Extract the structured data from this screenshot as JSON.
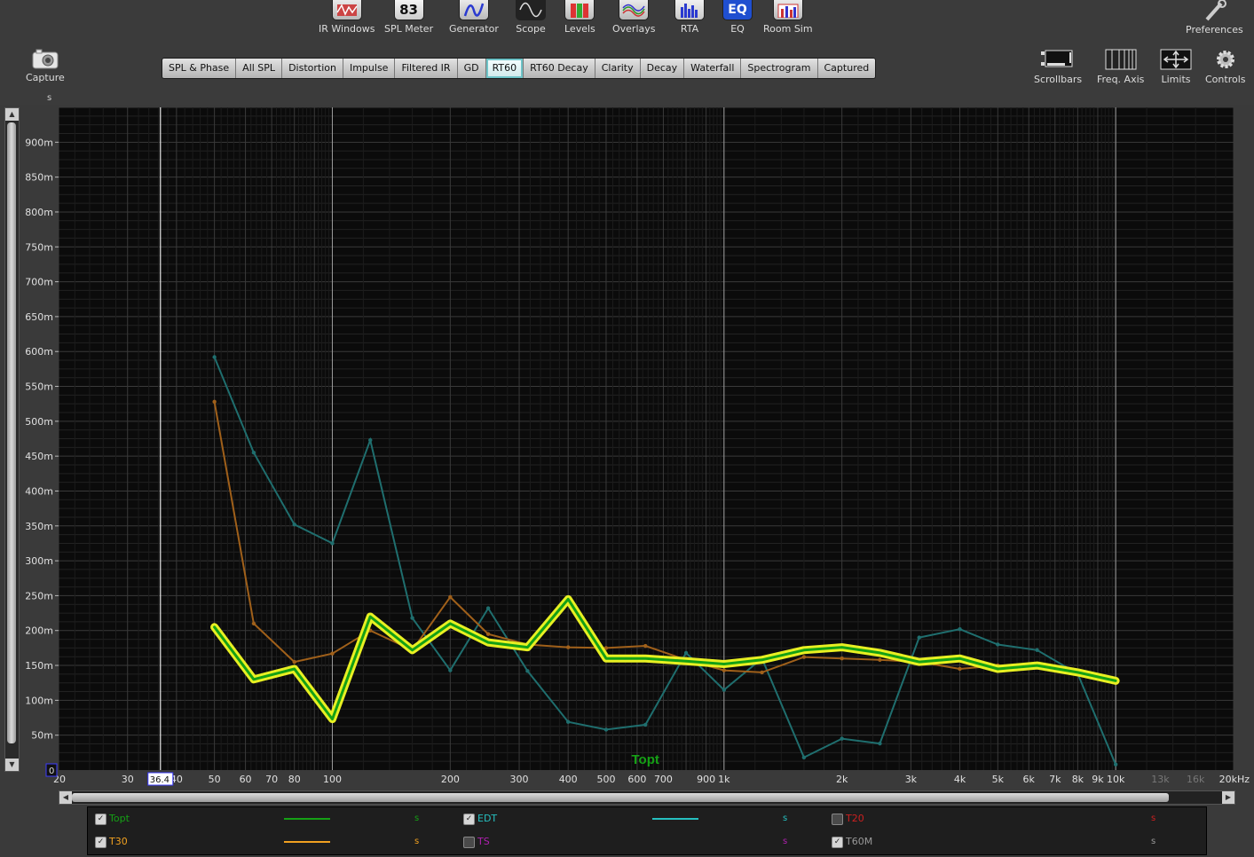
{
  "toolbar": {
    "tools": [
      {
        "id": "irwin",
        "label": "IR Windows",
        "icon": "ir-windows-icon"
      },
      {
        "id": "splmeter",
        "label": "SPL Meter",
        "icon": "spl-meter-icon",
        "value": "83"
      },
      {
        "id": "generator",
        "label": "Generator",
        "icon": "generator-icon"
      },
      {
        "id": "scope",
        "label": "Scope",
        "icon": "scope-icon"
      },
      {
        "id": "levels",
        "label": "Levels",
        "icon": "levels-icon"
      },
      {
        "id": "overlays",
        "label": "Overlays",
        "icon": "overlays-icon"
      },
      {
        "id": "rta",
        "label": "RTA",
        "icon": "rta-icon"
      },
      {
        "id": "eq",
        "label": "EQ",
        "icon": "eq-icon",
        "value": "EQ"
      },
      {
        "id": "roomsim",
        "label": "Room Sim",
        "icon": "room-sim-icon"
      }
    ],
    "preferences_label": "Preferences",
    "capture_label": "Capture",
    "right_tools": [
      {
        "id": "scrollbars",
        "label": "Scrollbars",
        "icon": "scrollbars-icon"
      },
      {
        "id": "freqaxis",
        "label": "Freq. Axis",
        "icon": "freq-axis-icon"
      },
      {
        "id": "limits",
        "label": "Limits",
        "icon": "limits-icon"
      },
      {
        "id": "controls",
        "label": "Controls",
        "icon": "gear-icon"
      }
    ]
  },
  "tabs": [
    "SPL & Phase",
    "All SPL",
    "Distortion",
    "Impulse",
    "Filtered IR",
    "GD",
    "RT60",
    "RT60 Decay",
    "Clarity",
    "Decay",
    "Waterfall",
    "Spectrogram",
    "Captured"
  ],
  "active_tab": "RT60",
  "colors": {
    "plot_bg": "#0b0b0b",
    "grid": "#2e2e2e",
    "topt": "#15a015",
    "topt_glow": "#e8f022",
    "t30": "#a0601a",
    "t30_legend": "#f0a020",
    "edt": "#1f6e6e",
    "edt_legend": "#26c0c0",
    "t20": "#cc2020",
    "ts": "#b020b0",
    "t60m": "#999999"
  },
  "chart_data": {
    "type": "line",
    "x_scale": "log",
    "xlim": [
      20,
      20000
    ],
    "ylim": [
      0,
      0.95
    ],
    "ylabel": "s",
    "y_ticks": [
      "900m",
      "850m",
      "800m",
      "750m",
      "700m",
      "650m",
      "600m",
      "550m",
      "500m",
      "450m",
      "400m",
      "350m",
      "300m",
      "250m",
      "200m",
      "150m",
      "100m",
      "50m"
    ],
    "y_tick_values": [
      0.9,
      0.85,
      0.8,
      0.75,
      0.7,
      0.65,
      0.6,
      0.55,
      0.5,
      0.45,
      0.4,
      0.35,
      0.3,
      0.25,
      0.2,
      0.15,
      0.1,
      0.05
    ],
    "x_ticks": [
      {
        "v": 20,
        "t": "20"
      },
      {
        "v": 30,
        "t": "30"
      },
      {
        "v": 40,
        "t": "40"
      },
      {
        "v": 50,
        "t": "50"
      },
      {
        "v": 60,
        "t": "60"
      },
      {
        "v": 70,
        "t": "70"
      },
      {
        "v": 80,
        "t": "80"
      },
      {
        "v": 100,
        "t": "100"
      },
      {
        "v": 200,
        "t": "200"
      },
      {
        "v": 300,
        "t": "300"
      },
      {
        "v": 400,
        "t": "400"
      },
      {
        "v": 500,
        "t": "500"
      },
      {
        "v": 600,
        "t": "600"
      },
      {
        "v": 700,
        "t": "700"
      },
      {
        "v": 900,
        "t": "900"
      },
      {
        "v": 1000,
        "t": "1k"
      },
      {
        "v": 2000,
        "t": "2k"
      },
      {
        "v": 3000,
        "t": "3k"
      },
      {
        "v": 4000,
        "t": "4k"
      },
      {
        "v": 5000,
        "t": "5k"
      },
      {
        "v": 6000,
        "t": "6k"
      },
      {
        "v": 7000,
        "t": "7k"
      },
      {
        "v": 8000,
        "t": "8k"
      },
      {
        "v": 9000,
        "t": "9k"
      },
      {
        "v": 10000,
        "t": "10k"
      },
      {
        "v": 13000,
        "t": "13k"
      },
      {
        "v": 16000,
        "t": "16k"
      },
      {
        "v": 20000,
        "t": "20kHz"
      }
    ],
    "x_ticks_dim_from": 13000,
    "cursor_freq": 36.4,
    "cursor_label": "36.4",
    "y_zero_label": "0",
    "marker_lines": [
      36.4,
      100,
      1000,
      10000
    ],
    "annotation": "Topt",
    "annotation_freq": 400,
    "series": [
      {
        "name": "EDT",
        "color": "#1f6e6e",
        "x": [
          50,
          63,
          80,
          100,
          125,
          160,
          200,
          250,
          315,
          400,
          500,
          630,
          800,
          1000,
          1250,
          1600,
          2000,
          2500,
          3150,
          4000,
          5000,
          6300,
          8000,
          10000
        ],
        "y": [
          0.592,
          0.455,
          0.352,
          0.325,
          0.473,
          0.218,
          0.143,
          0.232,
          0.142,
          0.069,
          0.058,
          0.065,
          0.168,
          0.115,
          0.16,
          0.018,
          0.045,
          0.038,
          0.19,
          0.202,
          0.18,
          0.172,
          0.138,
          0.008
        ]
      },
      {
        "name": "T30",
        "color": "#a0601a",
        "x": [
          50,
          63,
          80,
          100,
          125,
          160,
          200,
          250,
          315,
          400,
          500,
          630,
          800,
          1000,
          1250,
          1600,
          2000,
          2500,
          3150,
          4000,
          5000,
          6300,
          8000,
          10000
        ],
        "y": [
          0.528,
          0.21,
          0.155,
          0.167,
          0.2,
          0.172,
          0.248,
          0.195,
          0.18,
          0.176,
          0.175,
          0.178,
          0.158,
          0.143,
          0.14,
          0.162,
          0.16,
          0.158,
          0.155,
          0.145,
          0.15,
          0.148,
          0.14,
          0.125
        ]
      },
      {
        "name": "Topt",
        "color": "#15a015",
        "x": [
          50,
          63,
          80,
          100,
          125,
          160,
          200,
          250,
          315,
          400,
          500,
          630,
          800,
          1000,
          1250,
          1600,
          2000,
          2500,
          3150,
          4000,
          5000,
          6300,
          8000,
          10000
        ],
        "y": [
          0.205,
          0.13,
          0.145,
          0.073,
          0.22,
          0.172,
          0.21,
          0.183,
          0.176,
          0.245,
          0.16,
          0.16,
          0.156,
          0.152,
          0.158,
          0.172,
          0.176,
          0.168,
          0.155,
          0.16,
          0.145,
          0.15,
          0.14,
          0.128
        ]
      }
    ]
  },
  "legend": [
    {
      "id": "topt",
      "name": "Topt",
      "checked": true,
      "color": "#15a015",
      "line": true,
      "unit": "s"
    },
    {
      "id": "edt",
      "name": "EDT",
      "checked": true,
      "color": "#26c0c0",
      "line": true,
      "unit": "s"
    },
    {
      "id": "t20",
      "name": "T20",
      "checked": false,
      "color": "#cc2020",
      "line": false,
      "unit": "s"
    },
    {
      "id": "t30",
      "name": "T30",
      "checked": true,
      "color": "#f0a020",
      "line": true,
      "unit": "s"
    },
    {
      "id": "ts",
      "name": "TS",
      "checked": false,
      "color": "#b020b0",
      "line": false,
      "unit": "s"
    },
    {
      "id": "t60m",
      "name": "T60M",
      "checked": true,
      "color": "#999999",
      "line": false,
      "unit": "s"
    }
  ]
}
